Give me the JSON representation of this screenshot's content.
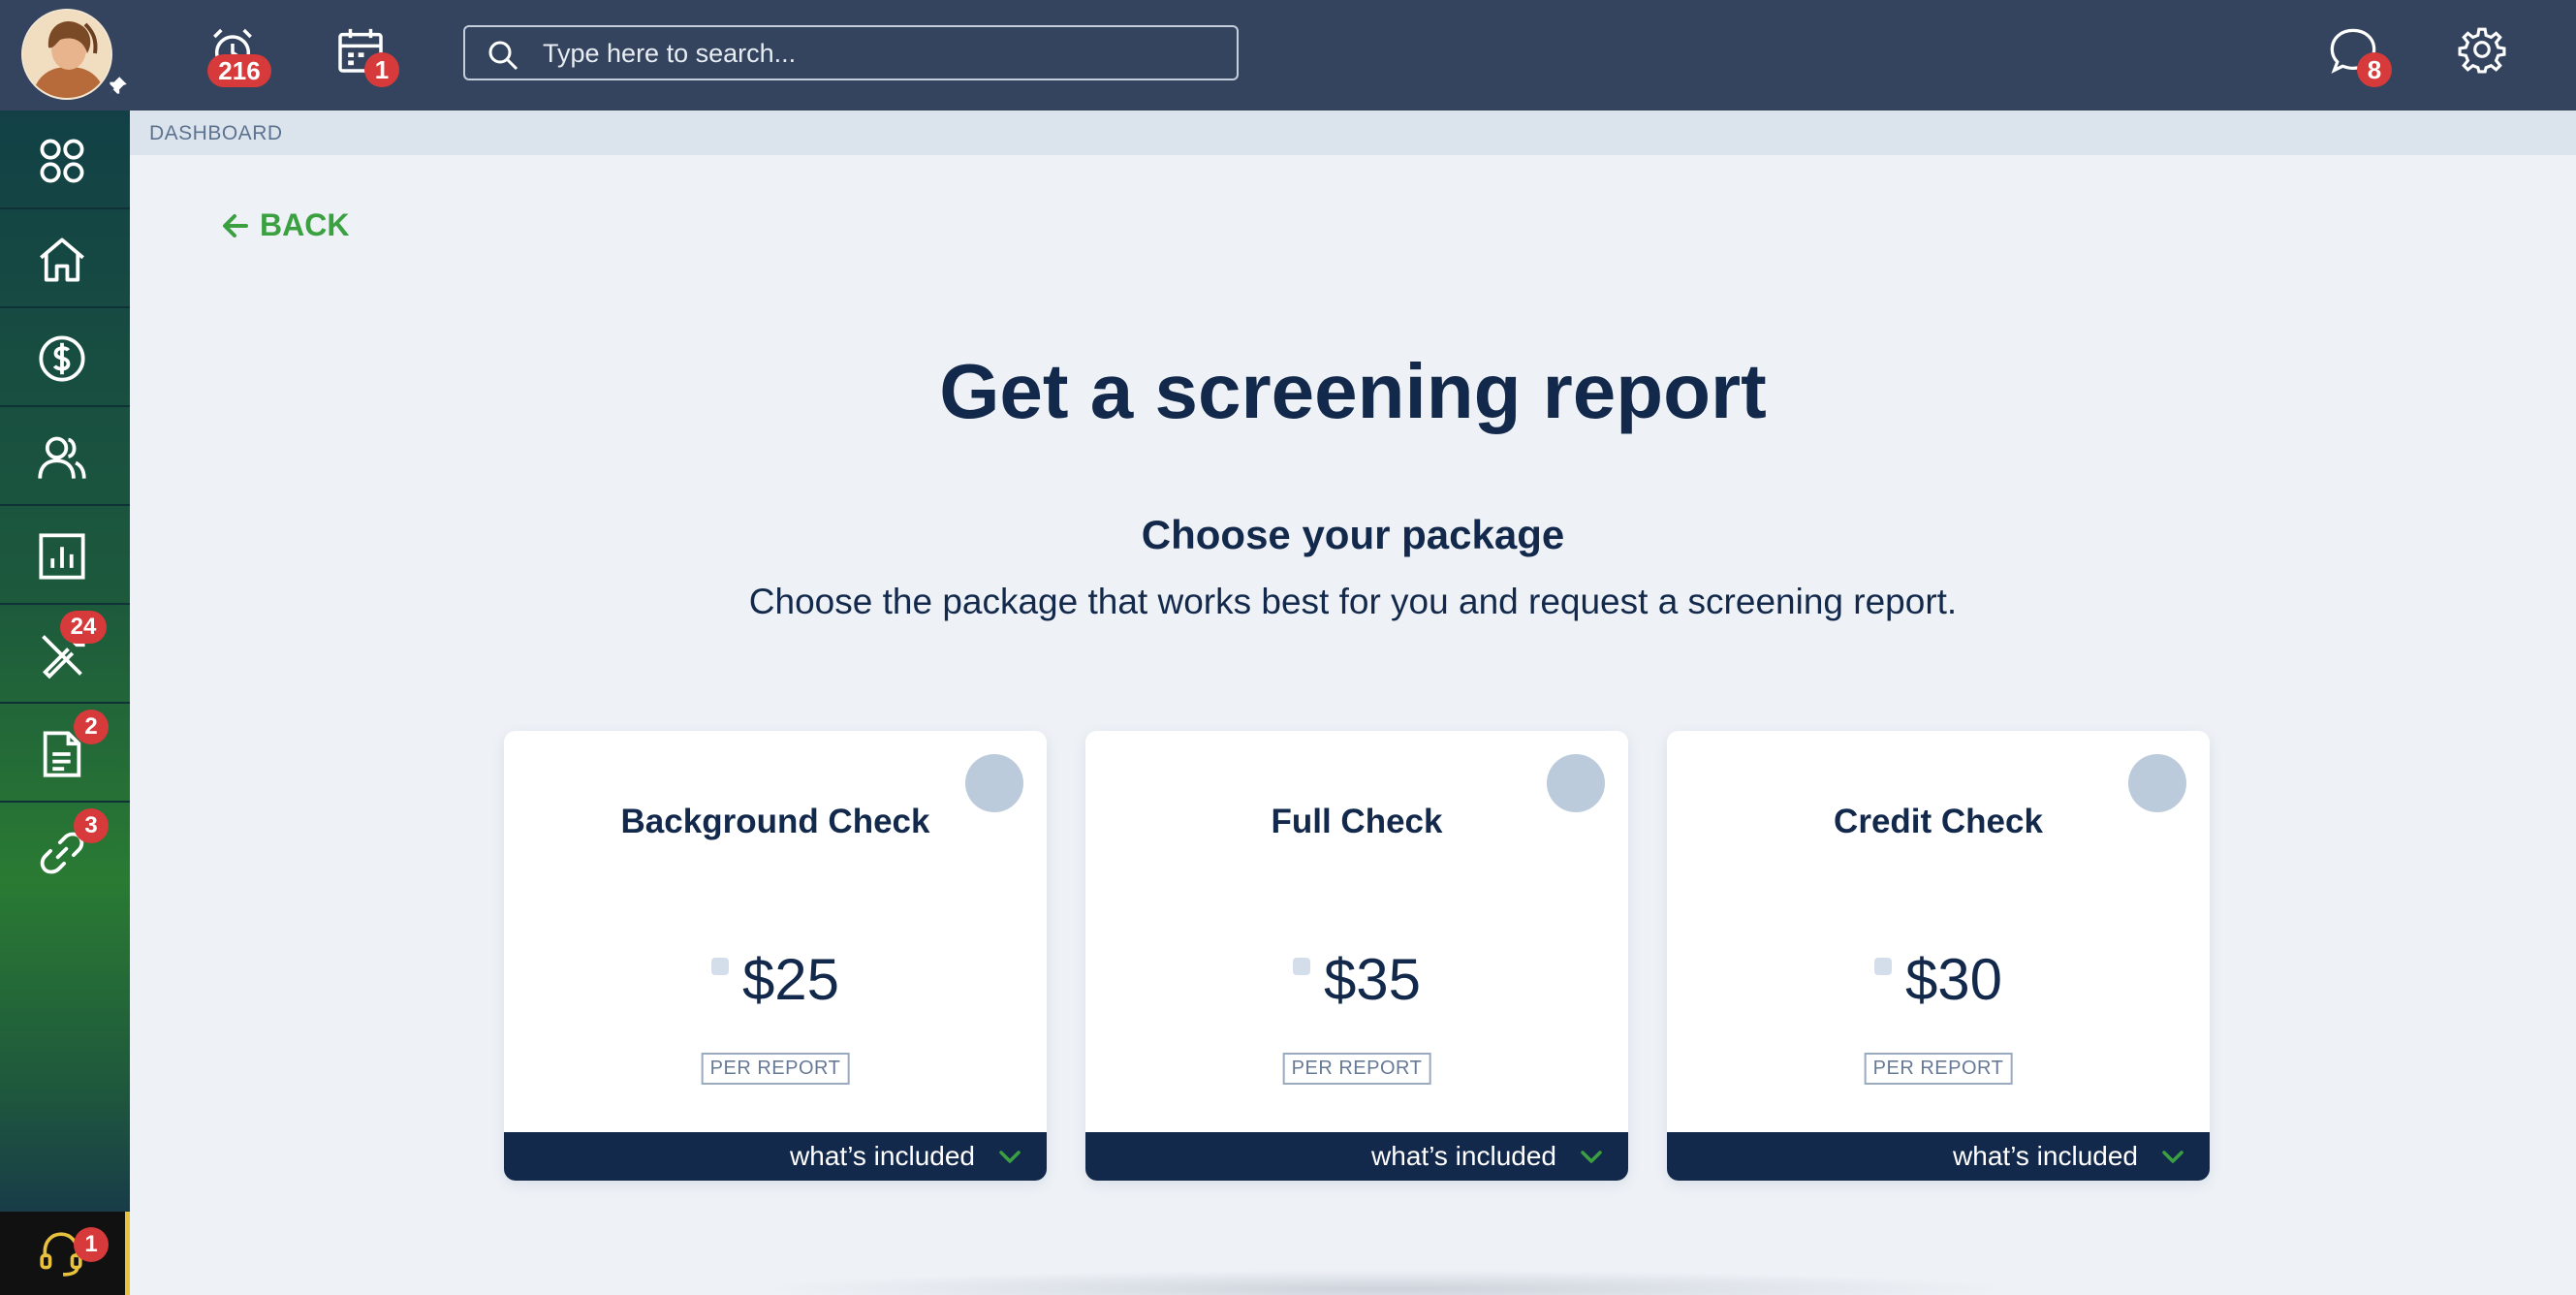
{
  "header": {
    "alarm_count": "216",
    "calendar_count": "1",
    "search_placeholder": "Type here to search...",
    "messages_count": "8"
  },
  "sidebar": {
    "items": [
      {
        "icon": "apps-grid-icon",
        "badge": ""
      },
      {
        "icon": "home-icon",
        "badge": ""
      },
      {
        "icon": "dollar-icon",
        "badge": ""
      },
      {
        "icon": "users-icon",
        "badge": ""
      },
      {
        "icon": "chart-icon",
        "badge": ""
      },
      {
        "icon": "tools-icon",
        "badge": "24"
      },
      {
        "icon": "document-icon",
        "badge": "2"
      },
      {
        "icon": "link-icon",
        "badge": "3"
      }
    ],
    "support_badge": "1"
  },
  "breadcrumb": "DASHBOARD",
  "back_label": "BACK",
  "page": {
    "title": "Get a screening report",
    "subtitle": "Choose your package",
    "description": "Choose the package that works best for you and request a screening report."
  },
  "packages": [
    {
      "name": "Background Check",
      "price": "$25",
      "per": "PER REPORT",
      "included": "what’s included"
    },
    {
      "name": "Full Check",
      "price": "$35",
      "per": "PER REPORT",
      "included": "what’s included"
    },
    {
      "name": "Credit Check",
      "price": "$30",
      "per": "PER REPORT",
      "included": "what’s included"
    }
  ],
  "colors": {
    "topbar": "#34445e",
    "accent_green": "#3aa040",
    "navy": "#13294b",
    "badge_red": "#d63a3a"
  }
}
